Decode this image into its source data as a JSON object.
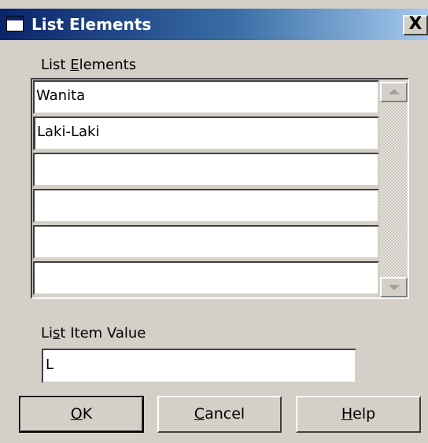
{
  "window": {
    "title": "List Elements",
    "close_glyph": "X"
  },
  "list_elements": {
    "label_prefix": "List ",
    "label_mnemonic": "E",
    "label_suffix": "lements",
    "items": [
      "Wanita",
      "Laki-Laki",
      "",
      "",
      "",
      ""
    ]
  },
  "list_item_value": {
    "label_prefix": "Li",
    "label_mnemonic": "s",
    "label_suffix": "t Item Value",
    "value": "L"
  },
  "buttons": {
    "ok": {
      "mnemonic": "O",
      "rest": "K"
    },
    "cancel": {
      "mnemonic": "C",
      "rest": "ancel"
    },
    "help": {
      "mnemonic": "H",
      "rest": "elp"
    }
  },
  "icons": {
    "title": "window-icon",
    "scroll_up": "up-arrow-icon",
    "scroll_down": "down-arrow-icon"
  },
  "colors": {
    "title_gradient_start": "#0a246a",
    "title_gradient_end": "#a6caf0",
    "dialog_face": "#d4d0c8"
  }
}
